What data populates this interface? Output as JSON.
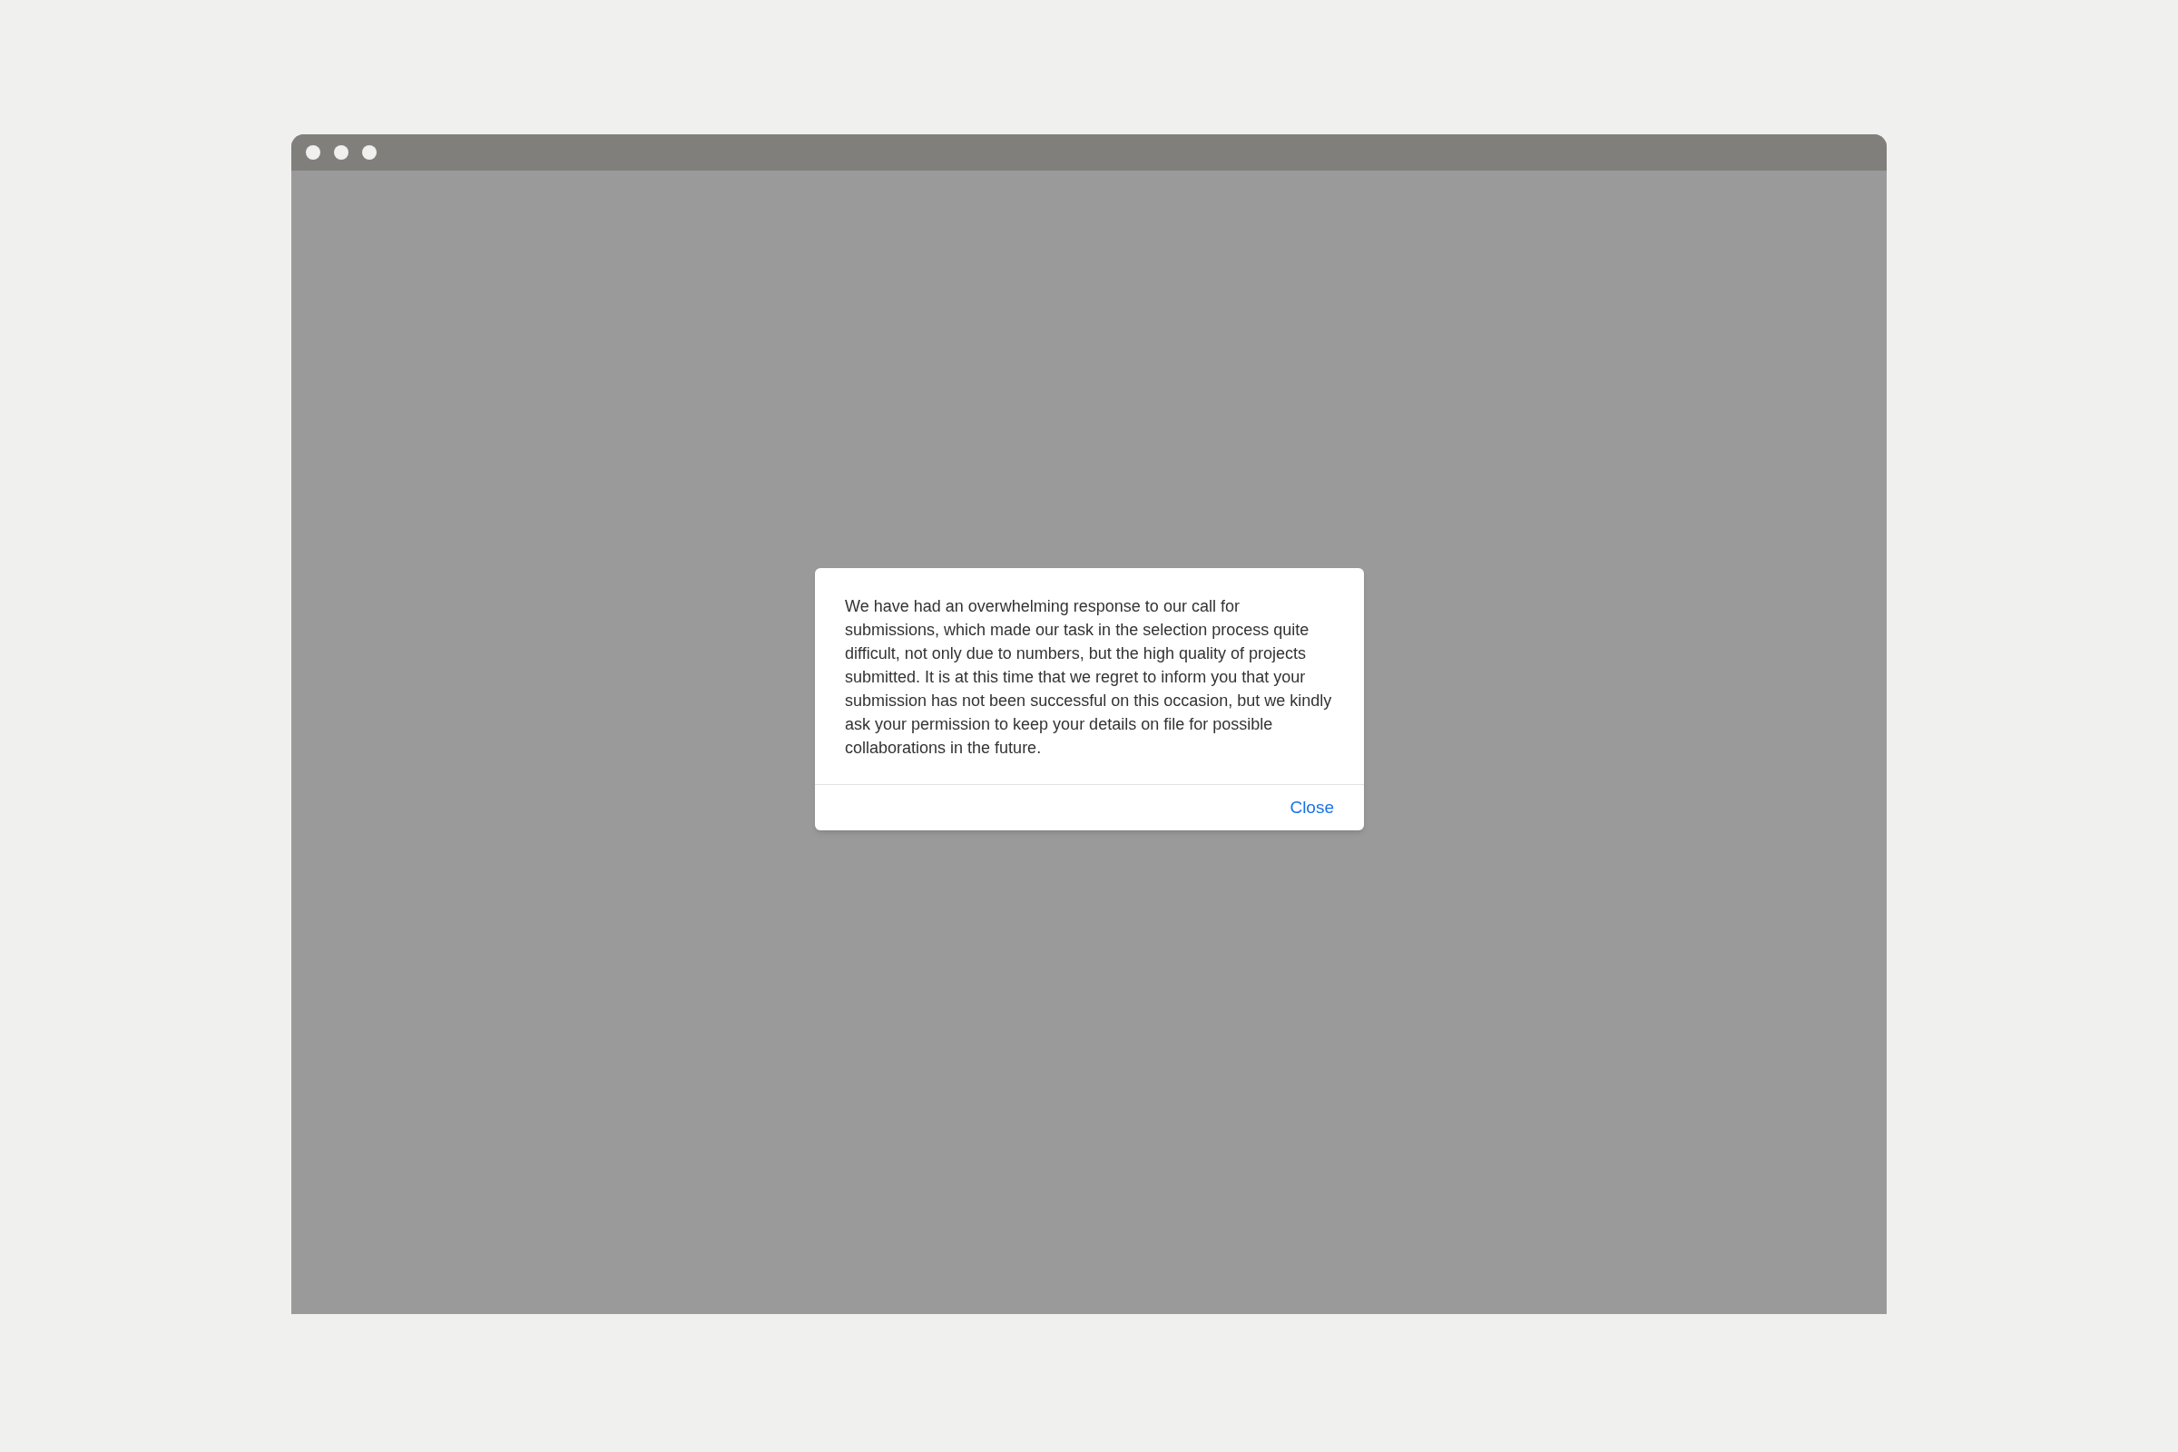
{
  "dialog": {
    "message": "We have had an overwhelming response to our call for submissions, which made our task in the selection process quite difficult, not only due to numbers, but the high quality of projects submitted. It is at this time that we regret to inform you that your submission has not been successful on this occasion, but we kindly ask your permission to keep your details on file for possible collaborations in the future.",
    "buttons": [
      "Close"
    ]
  }
}
